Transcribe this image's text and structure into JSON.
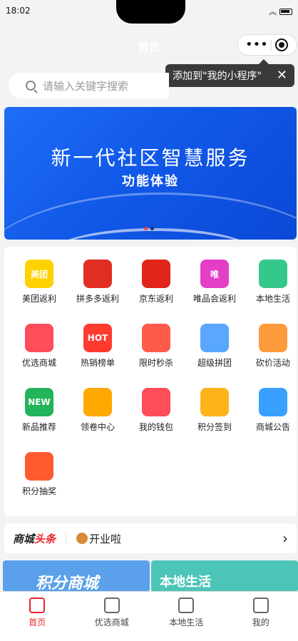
{
  "status_bar": {
    "time": "18:02"
  },
  "nav": {
    "title": "首页"
  },
  "capsule": {
    "more": "•••"
  },
  "tooltip": {
    "text": "添加到\"我的小程序\"",
    "close": "✕"
  },
  "search": {
    "placeholder": "请输入关键字搜索"
  },
  "banner": {
    "title": "新一代社区智慧服务",
    "subtitle": "功能体验"
  },
  "grid": [
    {
      "label": "美团返利",
      "icon": "meituan-icon",
      "color": "#ffd100",
      "text": "美团"
    },
    {
      "label": "拼多多返利",
      "icon": "pinduoduo-icon",
      "color": "#e02e24",
      "text": ""
    },
    {
      "label": "京东返利",
      "icon": "jd-icon",
      "color": "#e1251b",
      "text": ""
    },
    {
      "label": "唯品会返利",
      "icon": "vip-icon",
      "color": "#e43ec7",
      "text": "唯"
    },
    {
      "label": "本地生活",
      "icon": "store-icon",
      "color": "#35c88a",
      "text": ""
    },
    {
      "label": "优选商城",
      "icon": "cart-icon",
      "color": "#ff4d5a",
      "text": ""
    },
    {
      "label": "热销榜单",
      "icon": "hot-icon",
      "color": "#ff3b30",
      "text": "HOT"
    },
    {
      "label": "限时秒杀",
      "icon": "timer-icon",
      "color": "#ff5b4d",
      "text": ""
    },
    {
      "label": "超级拼团",
      "icon": "group-icon",
      "color": "#59a7ff",
      "text": ""
    },
    {
      "label": "砍价活动",
      "icon": "coupon-tag-icon",
      "color": "#ff9a3d",
      "text": ""
    },
    {
      "label": "新品推荐",
      "icon": "new-bag-icon",
      "color": "#23b35a",
      "text": "NEW"
    },
    {
      "label": "领卷中心",
      "icon": "ticket-icon",
      "color": "#ffa800",
      "text": ""
    },
    {
      "label": "我的钱包",
      "icon": "wallet-icon",
      "color": "#ff4d5a",
      "text": ""
    },
    {
      "label": "积分签到",
      "icon": "star-icon",
      "color": "#ffb31a",
      "text": ""
    },
    {
      "label": "商城公告",
      "icon": "megaphone-icon",
      "color": "#3aa0ff",
      "text": ""
    },
    {
      "label": "积分抽奖",
      "icon": "lottery-wheel-icon",
      "color": "#ff5b2e",
      "text": ""
    }
  ],
  "headline": {
    "brand_a": "商城",
    "brand_b": "头条",
    "news": "开业啦",
    "chevron": "›"
  },
  "promos": [
    {
      "text": "积分商城"
    },
    {
      "text": "本地生活"
    }
  ],
  "tabs": [
    {
      "label": "首页",
      "icon": "home-icon"
    },
    {
      "label": "优选商城",
      "icon": "cart-icon"
    },
    {
      "label": "本地生活",
      "icon": "bag-icon"
    },
    {
      "label": "我的",
      "icon": "user-icon"
    }
  ]
}
